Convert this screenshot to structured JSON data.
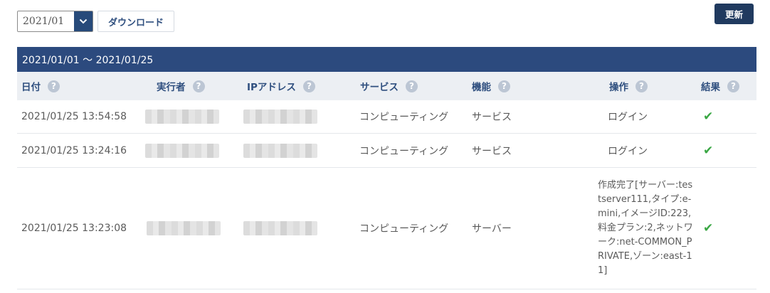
{
  "toolbar": {
    "month_value": "2021/01",
    "download_label": "ダウンロード",
    "refresh_label": "更新"
  },
  "range_label": "2021/01/01 ～ 2021/01/25",
  "columns": {
    "date": "日付",
    "executor": "実行者",
    "ip": "IPアドレス",
    "service": "サービス",
    "function": "機能",
    "operation": "操作",
    "result": "結果"
  },
  "help_glyph": "?",
  "check_glyph": "✔",
  "rows": [
    {
      "date": "2021/01/25 13:54:58",
      "service": "コンピューティング",
      "function": "サービス",
      "operation": "ログイン"
    },
    {
      "date": "2021/01/25 13:24:16",
      "service": "コンピューティング",
      "function": "サービス",
      "operation": "ログイン"
    },
    {
      "date": "2021/01/25 13:23:08",
      "service": "コンピューティング",
      "function": "サーバー",
      "operation": "作成完了[サーバー:testserver111,タイプ:e-mini,イメージID:223,料金プラン:2,ネットワーク:net-COMMON_PRIVATE,ゾーン:east-11]"
    }
  ]
}
